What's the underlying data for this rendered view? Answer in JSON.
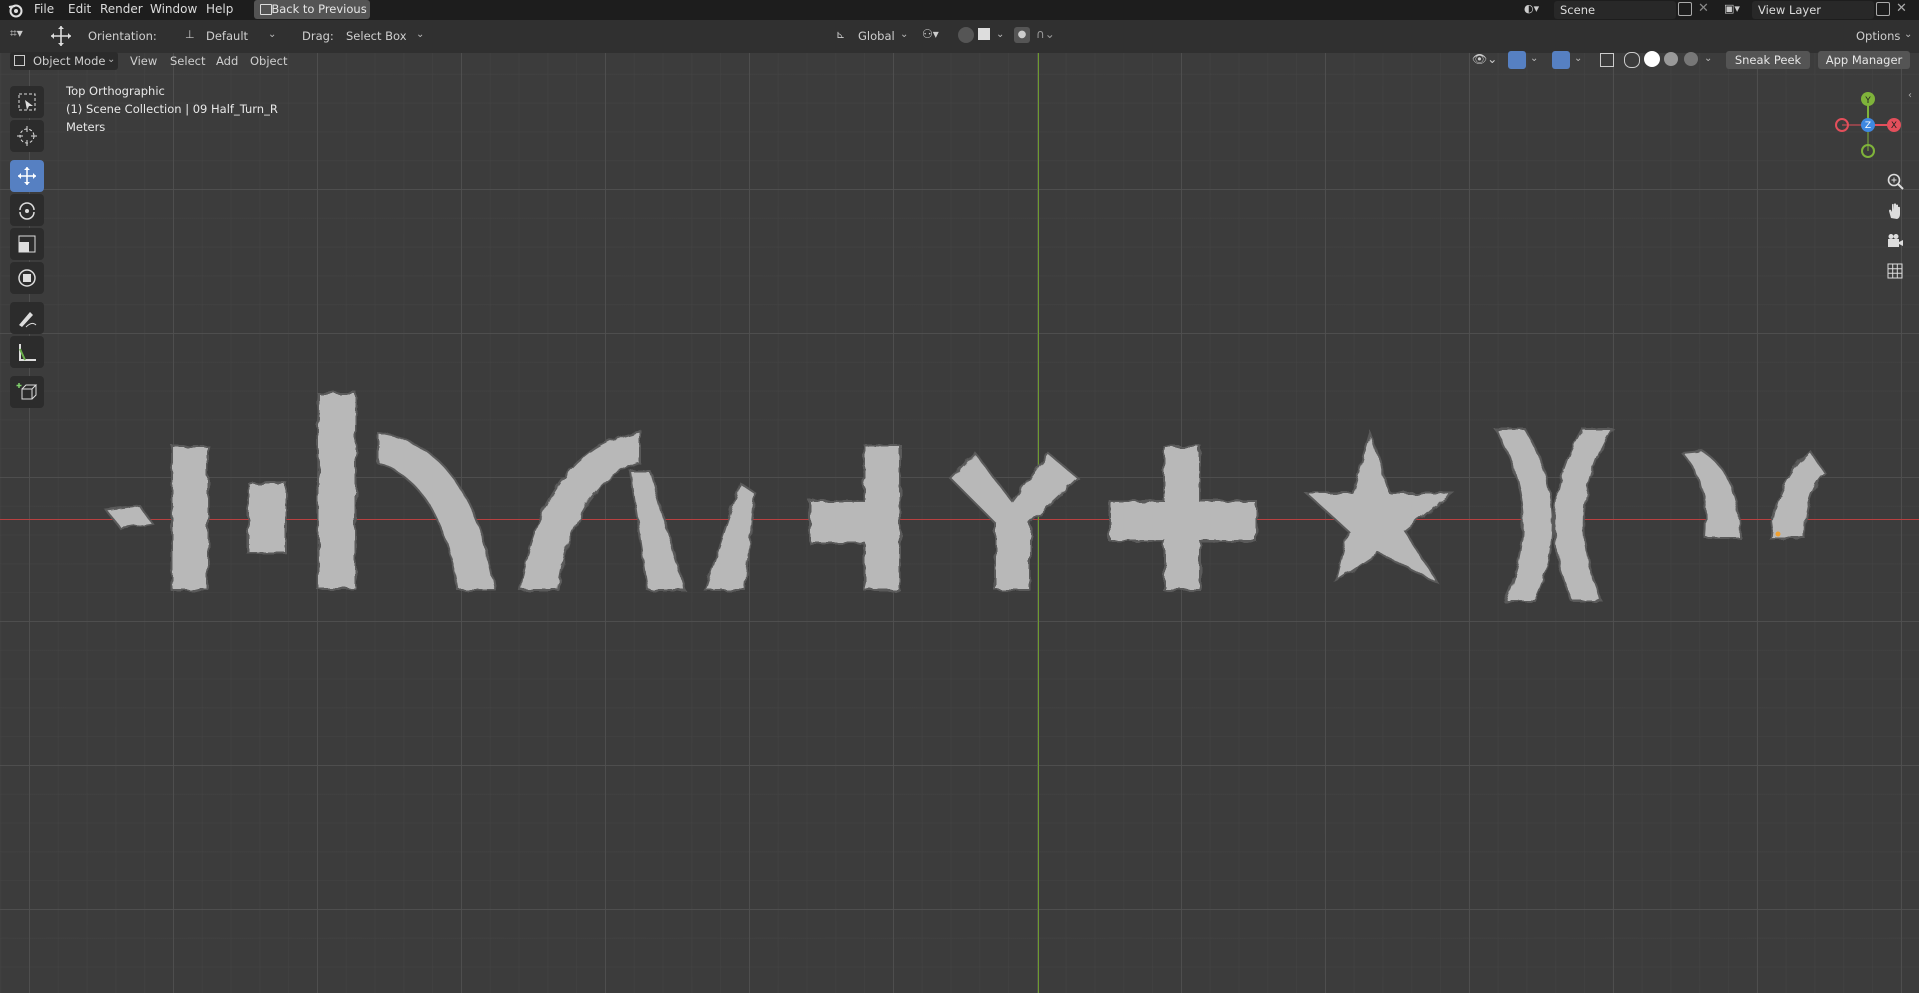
{
  "menubar": {
    "items": [
      "File",
      "Edit",
      "Render",
      "Window",
      "Help"
    ],
    "back_button": "Back to Previous",
    "scene_label": "Scene",
    "view_layer_label": "View Layer"
  },
  "toolbar": {
    "orientation_label": "Orientation:",
    "orientation_value": "Default",
    "drag_label": "Drag:",
    "drag_value": "Select Box",
    "transform_space": "Global",
    "options_label": "Options"
  },
  "header": {
    "mode": "Object Mode",
    "menus": [
      "View",
      "Select",
      "Add",
      "Object"
    ],
    "sneak_peek": "Sneak Peek",
    "app_manager": "App Manager"
  },
  "viewport": {
    "view_name": "Top Orthographic",
    "collection": "(1) Scene Collection | 09 Half_Turn_R",
    "units": "Meters"
  },
  "gizmo": {
    "y_label": "Y",
    "z_label": "Z",
    "x_label": "X",
    "colors": {
      "x": "#e34f5b",
      "y": "#7fb33a",
      "z": "#3f88e0"
    }
  },
  "colors": {
    "accent": "#5680c2",
    "x_axis": "#b84040",
    "y_axis": "#6e9a2e",
    "mesh": "#b8b8b8"
  }
}
